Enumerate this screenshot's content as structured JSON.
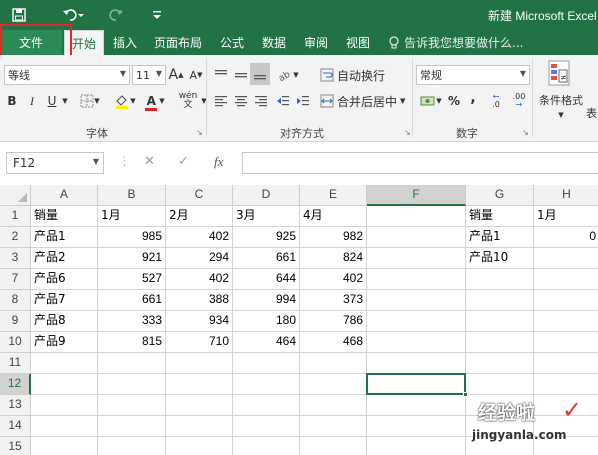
{
  "titlebar": {
    "title": "新建 Microsoft Excel"
  },
  "tabs": [
    {
      "label": "文件"
    },
    {
      "label": "开始"
    },
    {
      "label": "插入"
    },
    {
      "label": "页面布局"
    },
    {
      "label": "公式"
    },
    {
      "label": "数据"
    },
    {
      "label": "审阅"
    },
    {
      "label": "视图"
    }
  ],
  "tell_me": "告诉我您想要做什么...",
  "ribbon": {
    "font_name": "等线",
    "font_size": "11",
    "grow_font": "A",
    "shrink_font": "A",
    "bold": "B",
    "italic": "I",
    "underline": "U",
    "font_color": "A",
    "phonetic": "wén",
    "wrap_text": "自动换行",
    "merge_center": "合并后居中",
    "number_format": "常规",
    "percent": "%",
    "comma": ",",
    "inc_decimal": ".0",
    "dec_decimal": ".00",
    "cond_format": "条件格式",
    "table_format": "表",
    "groups": {
      "font": "字体",
      "alignment": "对齐方式",
      "number": "数字"
    }
  },
  "formula_bar": {
    "name_box": "F12",
    "fx": "fx",
    "value": ""
  },
  "sheet": {
    "columns": [
      "A",
      "B",
      "C",
      "D",
      "E",
      "F",
      "G",
      "H"
    ],
    "rows": [
      {
        "n": "1",
        "cells": [
          "销量",
          "1月",
          "2月",
          "3月",
          "4月",
          "",
          "销量",
          "1月"
        ]
      },
      {
        "n": "2",
        "cells": [
          "产品1",
          "985",
          "402",
          "925",
          "982",
          "",
          "产品1",
          "0"
        ]
      },
      {
        "n": "3",
        "cells": [
          "产品2",
          "921",
          "294",
          "661",
          "824",
          "",
          "产品10",
          ""
        ]
      },
      {
        "n": "7",
        "cells": [
          "产品6",
          "527",
          "402",
          "644",
          "402",
          "",
          "",
          ""
        ]
      },
      {
        "n": "8",
        "cells": [
          "产品7",
          "661",
          "388",
          "994",
          "373",
          "",
          "",
          ""
        ]
      },
      {
        "n": "9",
        "cells": [
          "产品8",
          "333",
          "934",
          "180",
          "786",
          "",
          "",
          ""
        ]
      },
      {
        "n": "10",
        "cells": [
          "产品9",
          "815",
          "710",
          "464",
          "468",
          "",
          "",
          ""
        ]
      },
      {
        "n": "11",
        "cells": [
          "",
          "",
          "",
          "",
          "",
          "",
          "",
          ""
        ]
      },
      {
        "n": "12",
        "cells": [
          "",
          "",
          "",
          "",
          "",
          "",
          "",
          ""
        ]
      },
      {
        "n": "13",
        "cells": [
          "",
          "",
          "",
          "",
          "",
          "",
          "",
          ""
        ]
      },
      {
        "n": "14",
        "cells": [
          "",
          "",
          "",
          "",
          "",
          "",
          "",
          ""
        ]
      },
      {
        "n": "15",
        "cells": [
          "",
          "",
          "",
          "",
          "",
          "",
          "",
          ""
        ]
      }
    ],
    "selected_cell": "F12",
    "selected_column": "F",
    "selected_row": "12"
  },
  "watermark": {
    "title": "经验啦",
    "url": "jingyanla.com"
  },
  "colors": {
    "accent": "#217346",
    "highlight": "#e02a2a"
  }
}
